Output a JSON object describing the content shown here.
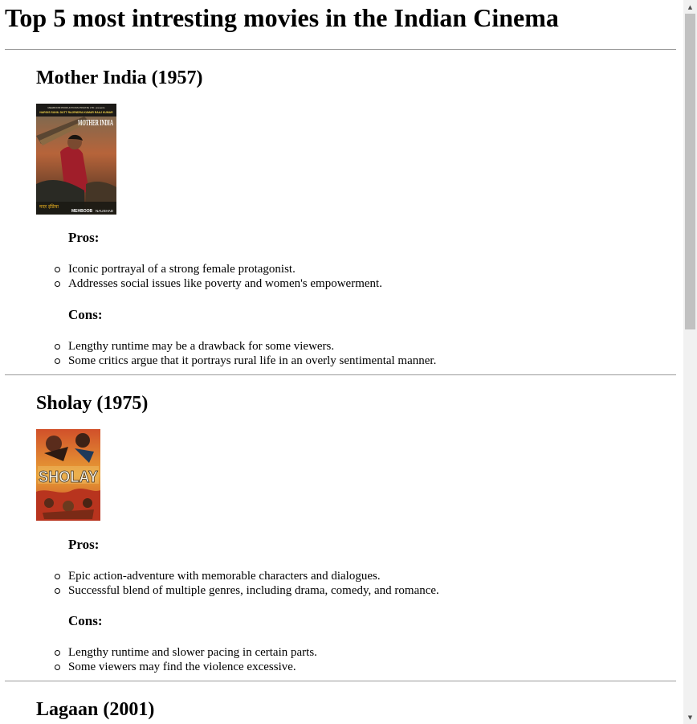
{
  "page": {
    "title": "Top 5 most intresting movies in the Indian Cinema"
  },
  "movies": [
    {
      "title": "Mother India (1957)",
      "poster": {
        "alt_text": "MOTHER INDIA",
        "credits_top": "MEHBOOB PRODUCTIONS PRIVATE LTD. presents",
        "credits_cast": "NARGIS SUNIL DUTT RAJENDRA KUMAR RAAJ KUMAR",
        "footer_left": "मदर इंडिया",
        "footer_mid": "MEHBOOB",
        "footer_right": "NAUSHAD"
      },
      "pros_label": "Pros:",
      "pros": [
        "Iconic portrayal of a strong female protagonist.",
        "Addresses social issues like poverty and women's empowerment."
      ],
      "cons_label": "Cons:",
      "cons": [
        "Lengthy runtime may be a drawback for some viewers.",
        "Some critics argue that it portrays rural life in an overly sentimental manner."
      ]
    },
    {
      "title": "Sholay (1975)",
      "poster": {
        "alt_text": "SHOLAY"
      },
      "pros_label": "Pros:",
      "pros": [
        "Epic action-adventure with memorable characters and dialogues.",
        "Successful blend of multiple genres, including drama, comedy, and romance."
      ],
      "cons_label": "Cons:",
      "cons": [
        "Lengthy runtime and slower pacing in certain parts.",
        "Some viewers may find the violence excessive."
      ]
    },
    {
      "title": "Lagaan (2001)"
    }
  ],
  "scrollbar": {
    "up_arrow": "▲",
    "down_arrow": "▼",
    "scroll_fraction": 0.0
  },
  "colors": {
    "divider": "#9a9a9a",
    "scrollbar_track": "#f1f1f1",
    "scrollbar_thumb": "#c1c1c1"
  }
}
